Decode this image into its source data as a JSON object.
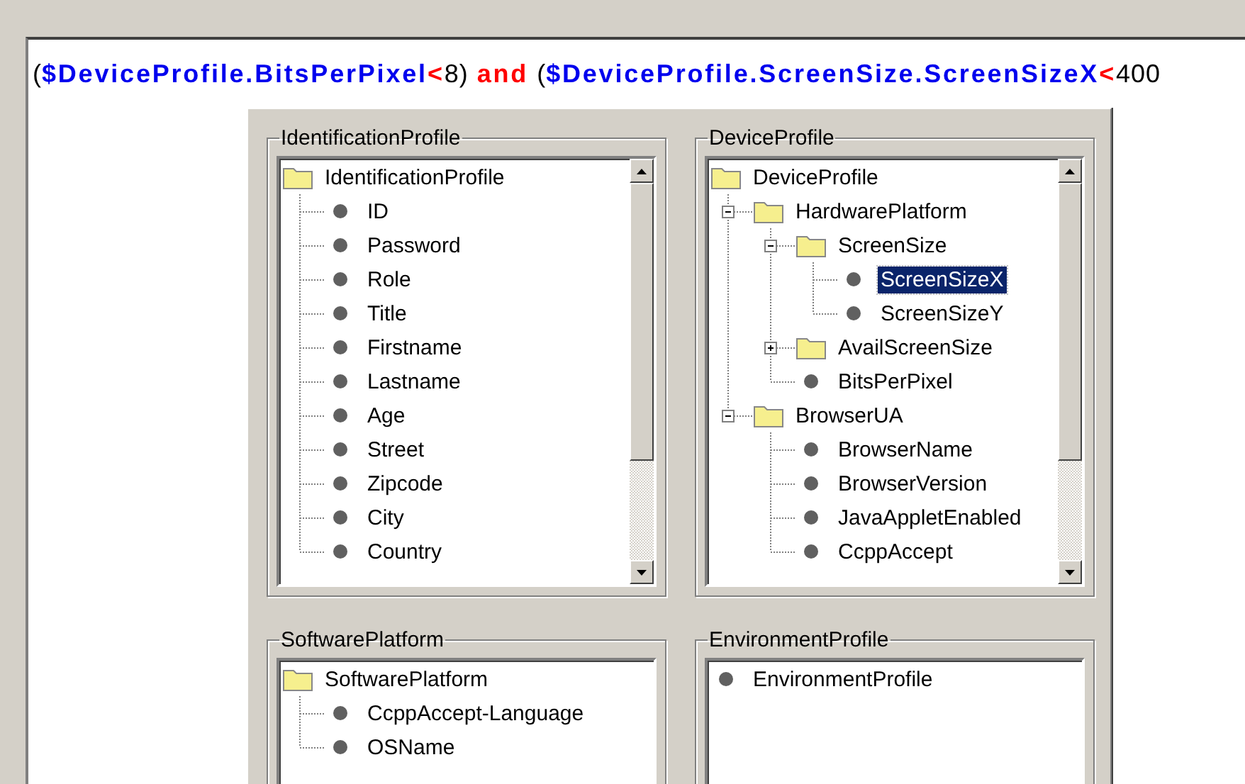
{
  "expression": [
    {
      "kind": "plain",
      "text": "("
    },
    {
      "kind": "variable",
      "text": "$DeviceProfile.BitsPerPixel"
    },
    {
      "kind": "operator",
      "text": "<"
    },
    {
      "kind": "plain",
      "text": "8)"
    },
    {
      "kind": "keyword",
      "text": "and"
    },
    {
      "kind": "plain",
      "text": "("
    },
    {
      "kind": "variable",
      "text": "$DeviceProfile.ScreenSize.ScreenSizeX"
    },
    {
      "kind": "operator",
      "text": "<"
    },
    {
      "kind": "plain",
      "text": "400"
    }
  ],
  "groups": [
    {
      "title": "IdentificationProfile",
      "scrollbar": true,
      "tree": [
        {
          "kind": "folder",
          "label": "IdentificationProfile",
          "selected": false,
          "children": [
            {
              "kind": "leaf",
              "label": "ID",
              "selected": false
            },
            {
              "kind": "leaf",
              "label": "Password",
              "selected": false
            },
            {
              "kind": "leaf",
              "label": "Role",
              "selected": false
            },
            {
              "kind": "leaf",
              "label": "Title",
              "selected": false
            },
            {
              "kind": "leaf",
              "label": "Firstname",
              "selected": false
            },
            {
              "kind": "leaf",
              "label": "Lastname",
              "selected": false
            },
            {
              "kind": "leaf",
              "label": "Age",
              "selected": false
            },
            {
              "kind": "leaf",
              "label": "Street",
              "selected": false
            },
            {
              "kind": "leaf",
              "label": "Zipcode",
              "selected": false
            },
            {
              "kind": "leaf",
              "label": "City",
              "selected": false
            },
            {
              "kind": "leaf",
              "label": "Country",
              "selected": false
            }
          ]
        }
      ]
    },
    {
      "title": "DeviceProfile",
      "scrollbar": true,
      "tree": [
        {
          "kind": "folder",
          "label": "DeviceProfile",
          "selected": false,
          "children": [
            {
              "kind": "folder",
              "label": "HardwarePlatform",
              "expanded": true,
              "selected": false,
              "children": [
                {
                  "kind": "folder",
                  "label": "ScreenSize",
                  "expanded": true,
                  "selected": false,
                  "children": [
                    {
                      "kind": "leaf",
                      "label": "ScreenSizeX",
                      "selected": true
                    },
                    {
                      "kind": "leaf",
                      "label": "ScreenSizeY",
                      "selected": false
                    }
                  ]
                },
                {
                  "kind": "folder",
                  "label": "AvailScreenSize",
                  "expanded": false,
                  "selected": false
                },
                {
                  "kind": "leaf",
                  "label": "BitsPerPixel",
                  "selected": false
                }
              ]
            },
            {
              "kind": "folder",
              "label": "BrowserUA",
              "expanded": true,
              "selected": false,
              "children": [
                {
                  "kind": "leaf",
                  "label": "BrowserName",
                  "selected": false
                },
                {
                  "kind": "leaf",
                  "label": "BrowserVersion",
                  "selected": false
                },
                {
                  "kind": "leaf",
                  "label": "JavaAppletEnabled",
                  "selected": false
                },
                {
                  "kind": "leaf",
                  "label": "CcppAccept",
                  "selected": false
                }
              ]
            }
          ]
        }
      ]
    },
    {
      "title": "SoftwarePlatform",
      "scrollbar": false,
      "tree": [
        {
          "kind": "folder",
          "label": "SoftwarePlatform",
          "selected": false,
          "children": [
            {
              "kind": "leaf",
              "label": "CcppAccept-Language",
              "selected": false
            },
            {
              "kind": "leaf",
              "label": "OSName",
              "selected": false
            }
          ]
        }
      ]
    },
    {
      "title": "EnvironmentProfile",
      "scrollbar": false,
      "tree": [
        {
          "kind": "leaf",
          "label": "EnvironmentProfile",
          "selected": false
        }
      ]
    }
  ]
}
